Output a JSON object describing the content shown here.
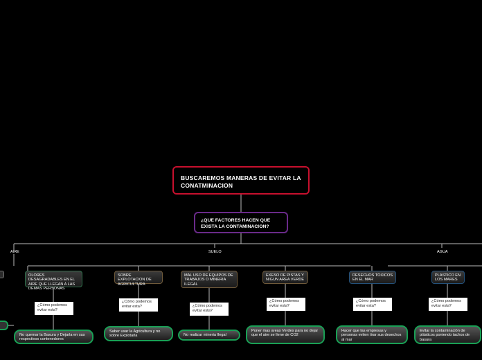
{
  "root": {
    "title": "BUSCAREMOS MANERAS DE EVITAR LA CONATMINACION"
  },
  "question": {
    "title": "¿QUE FACTORES HACEN QUE EXISTA LA CONTAMINACION?"
  },
  "branches": {
    "aire": "AIRE",
    "suelo": "SUELO",
    "agua": "AGUA"
  },
  "topics": [
    {
      "label": "OLORES DESAGRADABLES EN EL AIRE QUE LLEGAN A LAS DEMAS PERSONAS",
      "question": "¿Cómo podemos evitar esta?",
      "answer": "No quemar la Basura y Dejarla en sus respectivos contenedores"
    },
    {
      "label": "SOBRE EXPLOTACION DE AGRICULTURA",
      "question": "¿Cómo podemos evitar esta?",
      "answer": "Saber usar la Agricultura y no sobre Explotarla"
    },
    {
      "label": "MAL USO DE EQUIPOS DE TRABAJOS O MINERIA ILEGAL",
      "question": "¿Cómo podemos evitar esta?",
      "answer": "No realizar mineria Ilegal"
    },
    {
      "label": "EXESO DE PISTAS Y NIGUN AREA VERDE",
      "question": "¿Cómo podemos evitar esta?",
      "answer": "Poner mas areas Verdes para no dejar que el aire se llene de CO2"
    },
    {
      "label": "DESECHOS TOXICOS EN EL MAR",
      "question": "¿Cómo podemos evitar esta?",
      "answer": "Hacer que las empresas y personas eviten tirar sus desechos al mar"
    },
    {
      "label": "PLASTICO EN LOS MARES",
      "question": "¿Cómo podemos evitar esta?",
      "answer": "Evitar la contaminación de plásticos poniendo tachos de basura"
    }
  ],
  "colors": {
    "root_border": "#c8102e",
    "question_border": "#6a2a8a",
    "answer_border": "#19a055",
    "line": "#bbbbbb"
  }
}
